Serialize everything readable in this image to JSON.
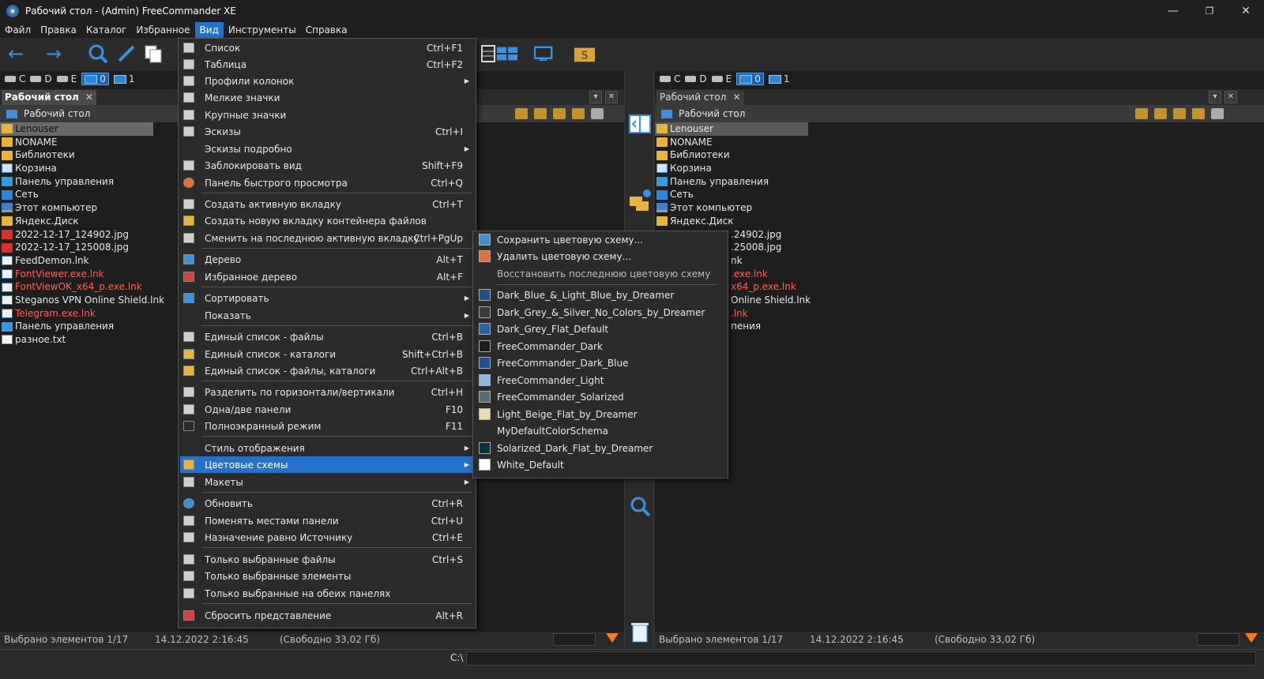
{
  "window": {
    "title": "Рабочий стол - (Admin) FreeCommander XE",
    "minimize": "—",
    "restore": "❐",
    "close": "✕"
  },
  "menubar": [
    "Файл",
    "Правка",
    "Каталог",
    "Избранное",
    "Вид",
    "Инструменты",
    "Справка"
  ],
  "drives": [
    {
      "label": "C"
    },
    {
      "label": "D"
    },
    {
      "label": "E"
    },
    {
      "label": "0"
    },
    {
      "label": "1"
    }
  ],
  "left_panel": {
    "tab": "Рабочий стол",
    "tab_close": "✕",
    "path": "Рабочий стол",
    "files": [
      {
        "name": "Lenouser",
        "icon": "folder"
      },
      {
        "name": "NONAME",
        "icon": "folder"
      },
      {
        "name": "Библиотеки",
        "icon": "folder"
      },
      {
        "name": "Корзина",
        "icon": "bin"
      },
      {
        "name": "Панель управления",
        "icon": "cpl"
      },
      {
        "name": "Сеть",
        "icon": "net"
      },
      {
        "name": "Этот компьютер",
        "icon": "pc"
      },
      {
        "name": "Яндекс.Диск",
        "icon": "folder"
      },
      {
        "name": "2022-12-17_124902.jpg",
        "icon": "jpg"
      },
      {
        "name": "2022-12-17_125008.jpg",
        "icon": "jpg"
      },
      {
        "name": "FeedDemon.lnk",
        "icon": "lnk"
      },
      {
        "name": "FontViewer.exe.lnk",
        "icon": "lnk"
      },
      {
        "name": "FontViewOK_x64_p.exe.lnk",
        "icon": "lnk"
      },
      {
        "name": "Steganos VPN Online Shield.lnk",
        "icon": "lnk"
      },
      {
        "name": "Telegram.exe.lnk",
        "icon": "lnk"
      },
      {
        "name": "Панель управления",
        "icon": "cpl"
      },
      {
        "name": "разное.txt",
        "icon": "txt"
      }
    ],
    "status": {
      "selected": "Выбрано элементов 1/17",
      "date": "14.12.2022 2:16:45",
      "free": "(Свободно 33,02 Гб)"
    }
  },
  "right_panel": {
    "tab": "Рабочий стол",
    "tab_close": "✕",
    "path": "Рабочий стол",
    "files": [
      {
        "name": "Lenouser",
        "icon": "folder"
      },
      {
        "name": "NONAME",
        "icon": "folder"
      },
      {
        "name": "Библиотеки",
        "icon": "folder"
      },
      {
        "name": "Корзина",
        "icon": "bin"
      },
      {
        "name": "Панель управления",
        "icon": "cpl"
      },
      {
        "name": "Сеть",
        "icon": "net"
      },
      {
        "name": "Этот компьютер",
        "icon": "pc"
      },
      {
        "name": "Яндекс.Диск",
        "icon": "folder"
      }
    ],
    "partial_files": [
      ".24902.jpg",
      ".25008.jpg",
      "nk",
      ".exe.lnk",
      "x64_p.exe.lnk",
      "Online Shield.lnk",
      ".lnk",
      "пения"
    ],
    "status": {
      "selected": "Выбрано элементов 1/17",
      "date": "14.12.2022 2:16:45",
      "free": "(Свободно 33,02 Гб)"
    }
  },
  "cmdbar": {
    "label": "C:\\"
  },
  "view_menu": {
    "items": [
      {
        "label": "Список",
        "key": "Ctrl+F1"
      },
      {
        "label": "Таблица",
        "key": "Ctrl+F2"
      },
      {
        "label": "Профили колонок",
        "key": "",
        "submenu": true
      },
      {
        "label": "Мелкие значки",
        "key": ""
      },
      {
        "label": "Крупные значки",
        "key": ""
      },
      {
        "label": "Эскизы",
        "key": "Ctrl+I"
      },
      {
        "label": "Эскизы подробно",
        "key": "",
        "submenu": true
      },
      {
        "label": "Заблокировать вид",
        "key": "Shift+F9"
      },
      {
        "label": "Панель быстрого просмотра",
        "key": "Ctrl+Q"
      },
      {
        "label": "Создать активную вкладку",
        "key": "Ctrl+T"
      },
      {
        "label": "Создать новую вкладку контейнера файлов",
        "key": ""
      },
      {
        "label": "Сменить на последнюю активную вкладку",
        "key": "Ctrl+PgUp"
      },
      {
        "label": "Дерево",
        "key": "Alt+T"
      },
      {
        "label": "Избранное дерево",
        "key": "Alt+F"
      },
      {
        "label": "Сортировать",
        "key": "",
        "submenu": true
      },
      {
        "label": "Показать",
        "key": "",
        "submenu": true
      },
      {
        "label": "Единый список - файлы",
        "key": "Ctrl+B"
      },
      {
        "label": "Единый список - каталоги",
        "key": "Shift+Ctrl+B"
      },
      {
        "label": "Единый список - файлы, каталоги",
        "key": "Ctrl+Alt+B"
      },
      {
        "label": "Разделить по горизонтали/вертикали",
        "key": "Ctrl+H"
      },
      {
        "label": "Одна/две панели",
        "key": "F10"
      },
      {
        "label": "Полноэкранный режим",
        "key": "F11"
      },
      {
        "label": "Стиль отображения",
        "key": "",
        "submenu": true
      },
      {
        "label": "Цветовые схемы",
        "key": "",
        "submenu": true
      },
      {
        "label": "Макеты",
        "key": "",
        "submenu": true
      },
      {
        "label": "Обновить",
        "key": "Ctrl+R"
      },
      {
        "label": "Поменять местами панели",
        "key": "Ctrl+U"
      },
      {
        "label": "Назначение равно Источнику",
        "key": "Ctrl+E"
      },
      {
        "label": "Только выбранные файлы",
        "key": "Ctrl+S"
      },
      {
        "label": "Только выбранные элементы",
        "key": ""
      },
      {
        "label": "Только выбранные на обеих панелях",
        "key": ""
      },
      {
        "label": "Сбросить представление",
        "key": "Alt+R"
      }
    ]
  },
  "color_schemes_menu": {
    "actions": [
      {
        "label": "Сохранить цветовую схему...",
        "enabled": true
      },
      {
        "label": "Удалить цветовую схему...",
        "enabled": true
      },
      {
        "label": "Восстановить последнюю цветовую схему",
        "enabled": false
      }
    ],
    "schemes": [
      {
        "label": "Dark_Blue_&_Light_Blue_by_Dreamer",
        "swatch": "#1f4f8f"
      },
      {
        "label": "Dark_Grey_&_Silver_No_Colors_by_Dreamer",
        "swatch": "#3a3a3a"
      },
      {
        "label": "Dark_Grey_Flat_Default",
        "swatch": "#2a62a8"
      },
      {
        "label": "FreeCommander_Dark",
        "swatch": "#1e1e1e"
      },
      {
        "label": "FreeCommander_Dark_Blue",
        "swatch": "#1a4f9a"
      },
      {
        "label": "FreeCommander_Light",
        "swatch": "#8ab8e8"
      },
      {
        "label": "FreeCommander_Solarized",
        "swatch": "#586e75"
      },
      {
        "label": "Light_Beige_Flat_by_Dreamer",
        "swatch": "#e8dcb0"
      },
      {
        "label": "MyDefaultColorSchema",
        "swatch": ""
      },
      {
        "label": "Solarized_Dark_Flat_by_Dreamer",
        "swatch": "#073642"
      },
      {
        "label": "White_Default",
        "swatch": "#ffffff"
      }
    ]
  }
}
